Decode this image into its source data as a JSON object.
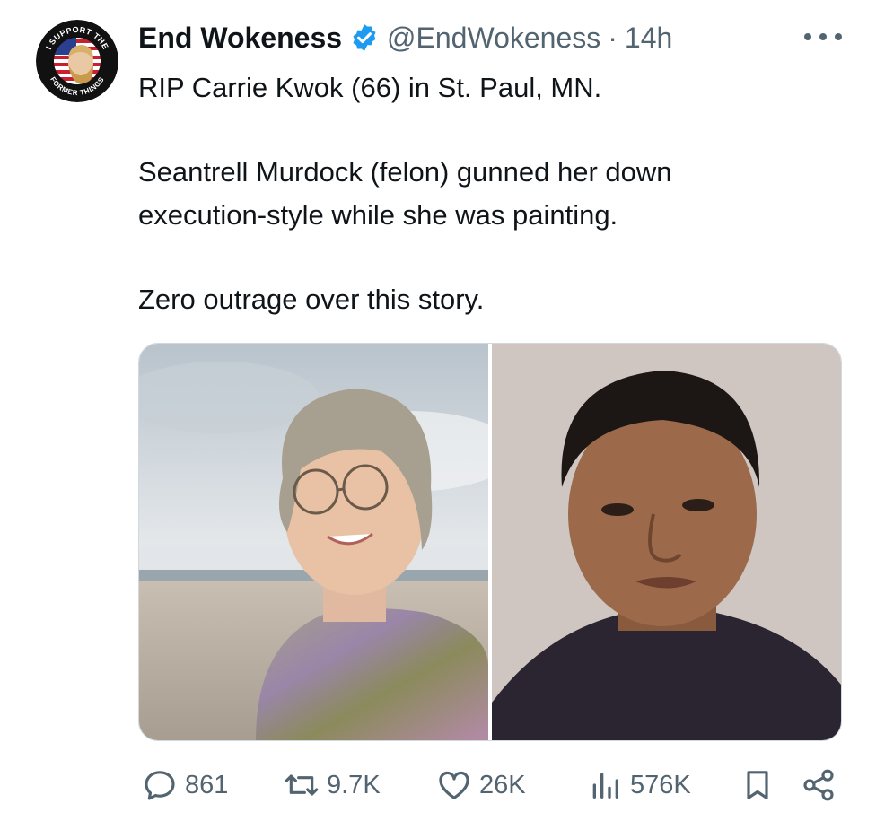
{
  "tweet": {
    "author_name": "End Wokeness",
    "handle": "@EndWokeness",
    "separator": "·",
    "time": "14h",
    "lines": [
      "RIP Carrie Kwok (66) in St. Paul, MN.",
      "Seantrell Murdock (felon) gunned her down",
      "execution-style while she was painting.",
      "Zero outrage over this story."
    ]
  },
  "avatar": {
    "top_text": "I SUPPORT THE",
    "bottom_text": "FORMER THINGS"
  },
  "stats": {
    "replies": "861",
    "reposts": "9.7K",
    "likes": "26K",
    "views": "576K"
  },
  "icons": {
    "verified": "verified-badge-icon",
    "more": "more-dots-icon",
    "reply": "reply-icon",
    "repost": "repost-icon",
    "like": "heart-icon",
    "views": "views-chart-icon",
    "bookmark": "bookmark-icon",
    "share": "share-icon"
  },
  "colors": {
    "text": "#0f1419",
    "secondary": "#536471",
    "verified_blue": "#1d9bf0",
    "border": "#cfd9de"
  }
}
